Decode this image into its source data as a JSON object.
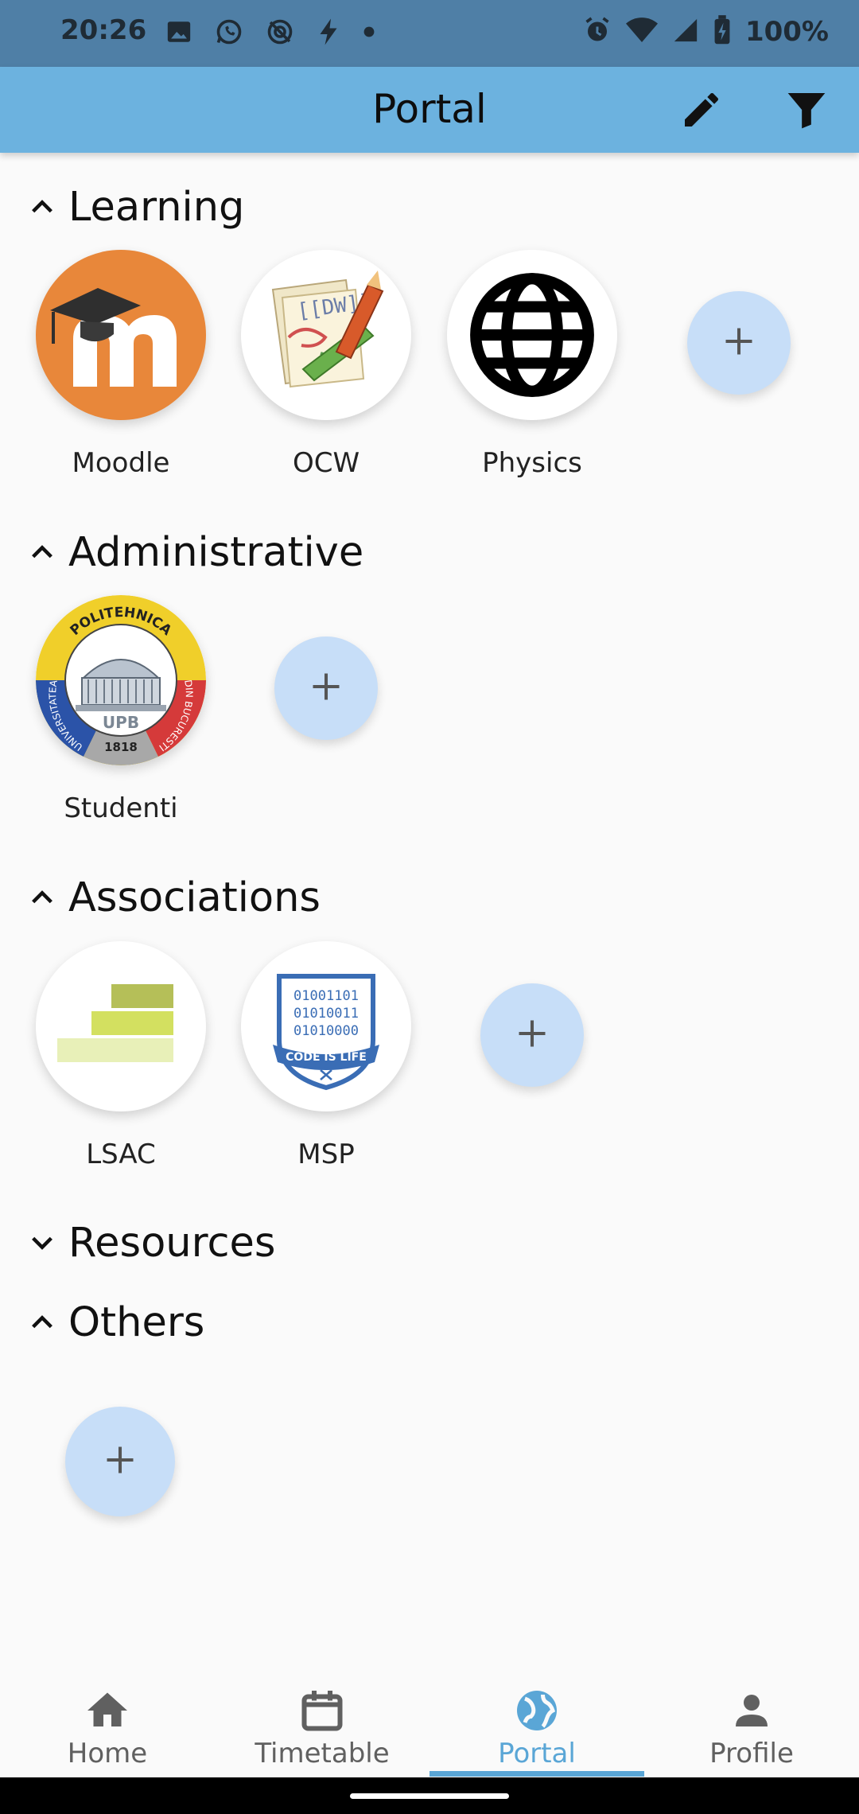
{
  "status": {
    "time": "20:26",
    "battery": "100%",
    "icons_left": [
      "image-icon",
      "whatsapp-icon",
      "sync-disabled-icon",
      "bolt-icon",
      "dot-icon"
    ],
    "icons_right": [
      "alarm-icon",
      "wifi-icon",
      "signal-icon",
      "battery-charging-icon"
    ]
  },
  "app_bar": {
    "title": "Portal",
    "actions": [
      "edit-icon",
      "filter-icon"
    ]
  },
  "sections": {
    "learning": {
      "title": "Learning",
      "expanded": true,
      "items": [
        {
          "label": "Moodle",
          "icon": "moodle-logo"
        },
        {
          "label": "OCW",
          "icon": "ocw-logo"
        },
        {
          "label": "Physics",
          "icon": "globe-icon"
        }
      ]
    },
    "administrative": {
      "title": "Administrative",
      "expanded": true,
      "items": [
        {
          "label": "Studenti",
          "icon": "upb-seal",
          "seal_text": [
            "POLITEHNICA",
            "UNIVERSITATEA",
            "DIN BUCURESTI",
            "UPB",
            "1818"
          ]
        }
      ]
    },
    "associations": {
      "title": "Associations",
      "expanded": true,
      "items": [
        {
          "label": "LSAC",
          "icon": "lsac-logo"
        },
        {
          "label": "MSP",
          "icon": "msp-logo",
          "logo_text": [
            "01001101",
            "01010011",
            "01010000",
            "CODE IS LIFE"
          ]
        }
      ]
    },
    "resources": {
      "title": "Resources",
      "expanded": false
    },
    "others": {
      "title": "Others",
      "expanded": true
    }
  },
  "add_symbol": "+",
  "bottom_nav": {
    "items": [
      {
        "label": "Home",
        "icon": "home-icon"
      },
      {
        "label": "Timetable",
        "icon": "calendar-icon"
      },
      {
        "label": "Portal",
        "icon": "globe-icon"
      },
      {
        "label": "Profile",
        "icon": "person-icon"
      }
    ],
    "active": "Portal"
  },
  "colors": {
    "status_bar": "#4f7fa6",
    "app_bar": "#6cb2df",
    "accent": "#5aa6d6",
    "add_button": "#c7def8",
    "moodle_orange": "#e8873a"
  }
}
